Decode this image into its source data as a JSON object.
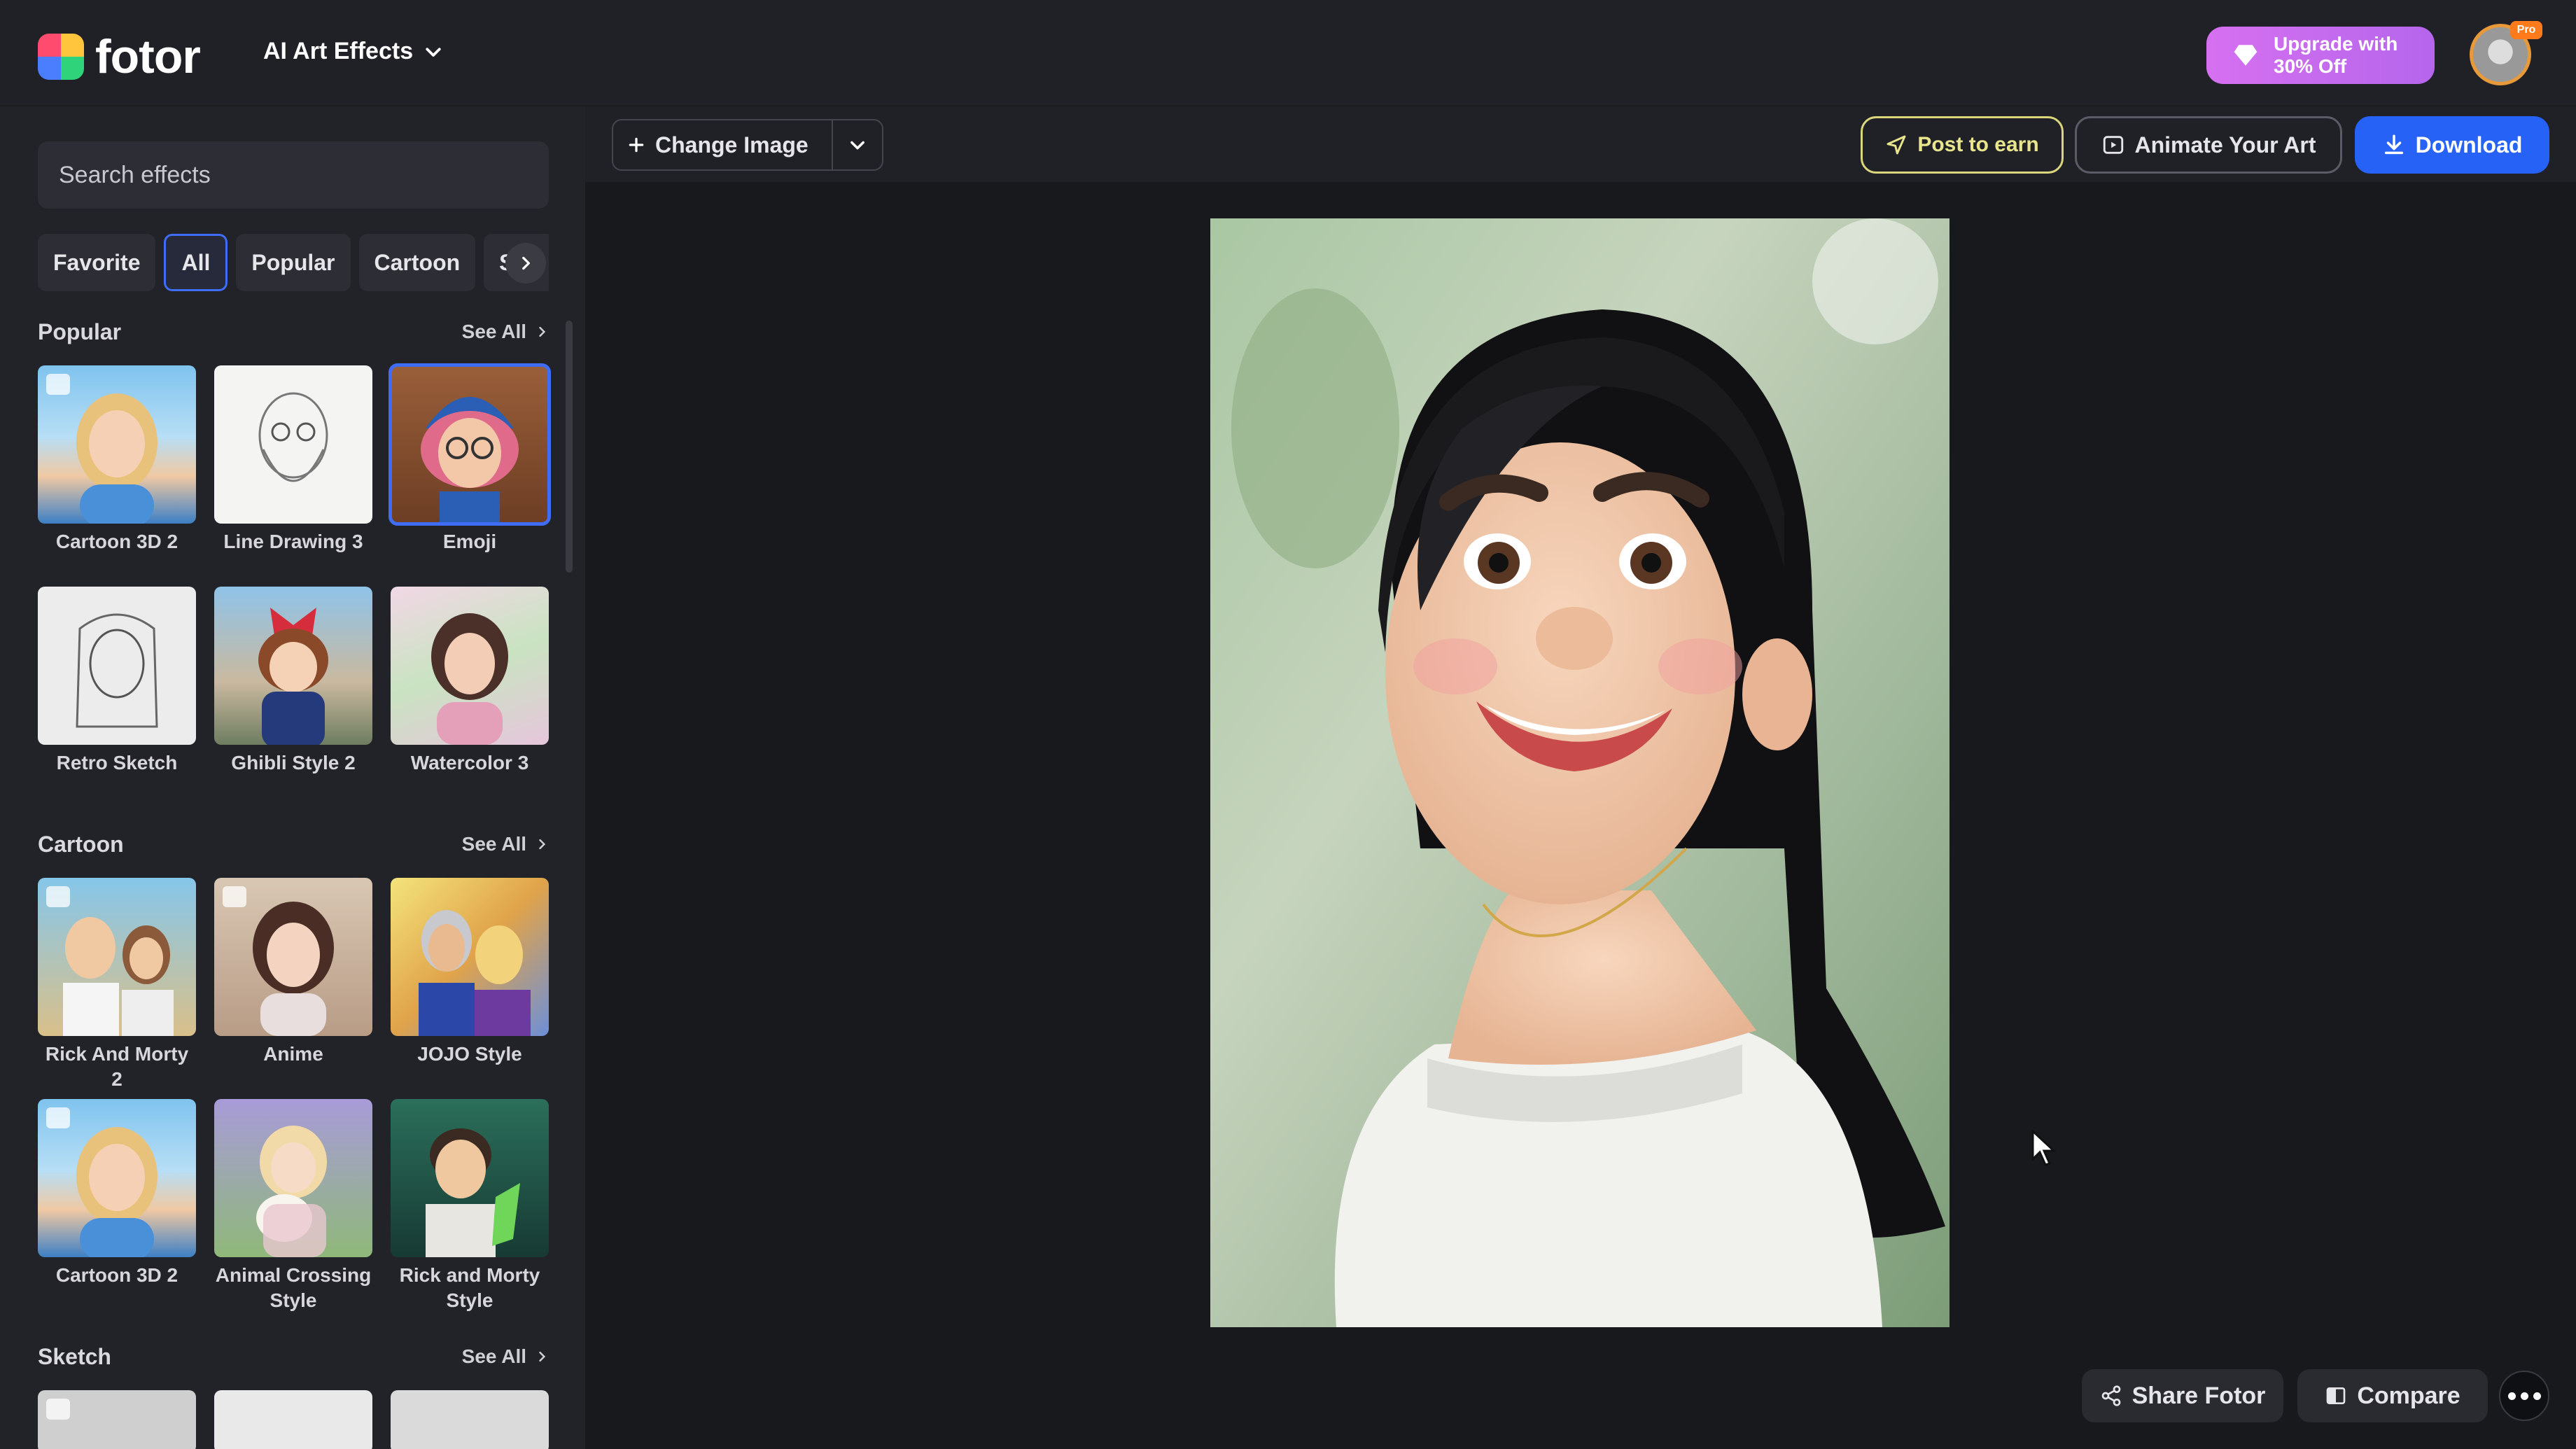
{
  "header": {
    "logo_text": "fotor",
    "menu_label": "AI Art Effects",
    "upgrade_line1": "Upgrade with",
    "upgrade_line2": "30% Off",
    "pro_badge": "Pro"
  },
  "sidebar": {
    "search_placeholder": "Search effects",
    "chips": [
      {
        "label": "Favorite",
        "active": false
      },
      {
        "label": "All",
        "active": true
      },
      {
        "label": "Popular",
        "active": false
      },
      {
        "label": "Cartoon",
        "active": false
      },
      {
        "label": "Ske",
        "active": false
      }
    ],
    "see_all": "See All",
    "sections": [
      {
        "title": "Popular",
        "items": [
          "Cartoon 3D 2",
          "Line Drawing 3",
          "Emoji",
          "Retro Sketch",
          "Ghibli Style 2",
          "Watercolor 3"
        ],
        "selected": "Emoji"
      },
      {
        "title": "Cartoon",
        "items": [
          "Rick And Morty 2",
          "Anime",
          "JOJO Style",
          "Cartoon 3D 2",
          "Animal Crossing Style",
          "Rick and Morty Style"
        ]
      },
      {
        "title": "Sketch",
        "items": []
      }
    ]
  },
  "toolbar": {
    "change_image": "Change Image",
    "post_to_earn": "Post to earn",
    "animate": "Animate Your Art",
    "download": "Download"
  },
  "footer": {
    "share": "Share Fotor",
    "compare": "Compare"
  },
  "colors": {
    "accent": "#2662f6",
    "upgrade": "#c86cef",
    "post_outline": "#d9d67b",
    "background": "#1c1d21"
  },
  "icons": [
    "chevron-down-icon",
    "plus-icon",
    "send-icon",
    "animate-icon",
    "download-icon",
    "share-icon",
    "compare-icon",
    "more-icon",
    "diamond-icon",
    "chevron-right-icon",
    "heart-icon",
    "cursor-icon"
  ]
}
